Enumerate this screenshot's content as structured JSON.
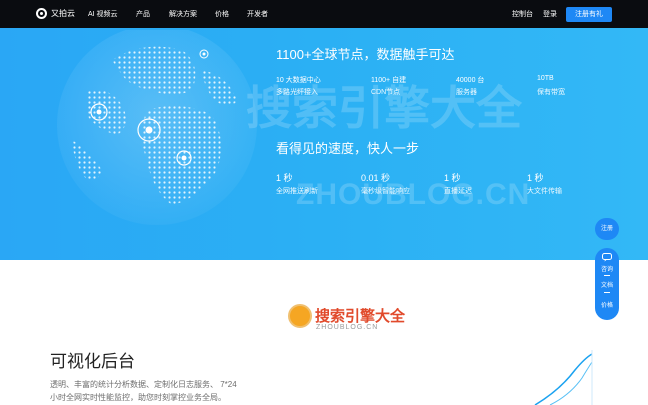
{
  "nav": {
    "logo": "又拍云",
    "items": [
      "AI 视频云",
      "产品",
      "解决方案",
      "价格",
      "开发者"
    ],
    "right": [
      "控制台",
      "登录"
    ],
    "cta": "注册有礼"
  },
  "hero": {
    "title1": "1100+全球节点，数据触手可达",
    "stats1": [
      {
        "top": "10 大数据中心",
        "bottom": "多路光纤接入"
      },
      {
        "top": "1100+ 自建",
        "bottom": "CDN节点"
      },
      {
        "top": "40000 台",
        "bottom": "服务器"
      },
      {
        "top": "10TB",
        "bottom": "保有带宽"
      }
    ],
    "title2": "看得见的速度，快人一步",
    "stats2": [
      {
        "top": "1 秒",
        "bottom": "全网推送刷新"
      },
      {
        "top": "0.01 秒",
        "bottom": "毫秒级智能响应"
      },
      {
        "top": "1 秒",
        "bottom": "直播延迟"
      },
      {
        "top": "1 秒",
        "bottom": "大文件传输"
      }
    ]
  },
  "watermark": {
    "cn": "搜索引擎大全",
    "en": "ZHOUBLOG.CN"
  },
  "float": {
    "register": "注册",
    "consult": "咨询",
    "docs": "文档",
    "price": "价格"
  },
  "section": {
    "brand": "搜索引擎大全",
    "brand_sub": "ZHOUBLOG.CN",
    "title": "可视化后台",
    "desc1": "透明、丰富的统计分析数据、定制化日志服务、 7*24",
    "desc2": "小时全网实时性能监控，助您时刻掌控业务全局。"
  },
  "colors": {
    "accent": "#1e88f5",
    "hero": "#2aa7f5",
    "nav": "#0a0c10"
  }
}
